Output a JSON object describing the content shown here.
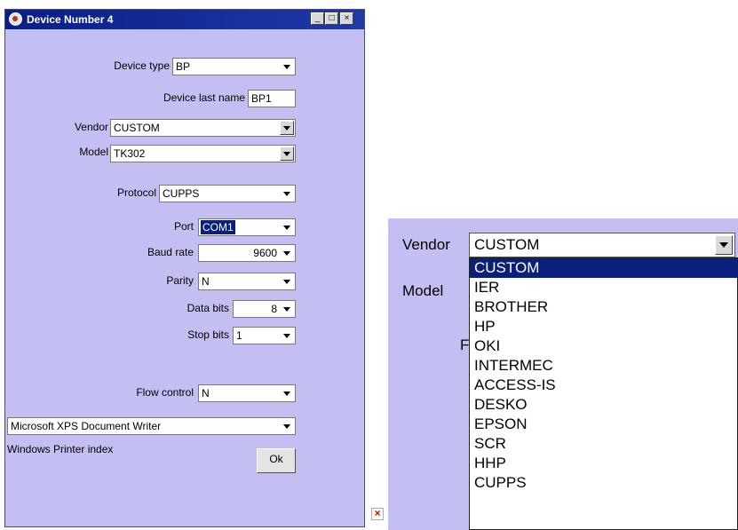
{
  "window": {
    "title": "Device Number 4",
    "controls": [
      "_",
      "□",
      "×"
    ]
  },
  "form": {
    "device_type": {
      "label": "Device type",
      "value": "BP"
    },
    "device_last_name": {
      "label": "Device last name",
      "value": "BP1"
    },
    "vendor": {
      "label": "Vendor",
      "value": "CUSTOM"
    },
    "model": {
      "label": "Model",
      "value": "TK302"
    },
    "protocol": {
      "label": "Protocol",
      "value": "CUPPS"
    },
    "port": {
      "label": "Port",
      "value": "COM1"
    },
    "baud_rate": {
      "label": "Baud rate",
      "value": "9600"
    },
    "parity": {
      "label": "Parity",
      "value": "N"
    },
    "data_bits": {
      "label": "Data bits",
      "value": "8"
    },
    "stop_bits": {
      "label": "Stop bits",
      "value": "1"
    },
    "flow_control": {
      "label": "Flow control",
      "value": "N"
    },
    "printer": {
      "value": "Microsoft XPS Document Writer"
    },
    "printer_index_label": "Windows Printer index",
    "ok_label": "Ok"
  },
  "broken_image": "×",
  "zoom": {
    "vendor_label": "Vendor",
    "vendor_value": "CUSTOM",
    "model_label": "Model",
    "obscured_letter": "F",
    "vendor_options": [
      "CUSTOM",
      "IER",
      "BROTHER",
      "HP",
      "OKI",
      "INTERMEC",
      "ACCESS-IS",
      "DESKO",
      "EPSON",
      "SCR",
      "HHP",
      "CUPPS"
    ],
    "selected_option": "CUSTOM"
  },
  "colors": {
    "dialog_bg": "#c3bff2",
    "titlebar": "#0a1f7c",
    "selection": "#0a1f7c"
  }
}
